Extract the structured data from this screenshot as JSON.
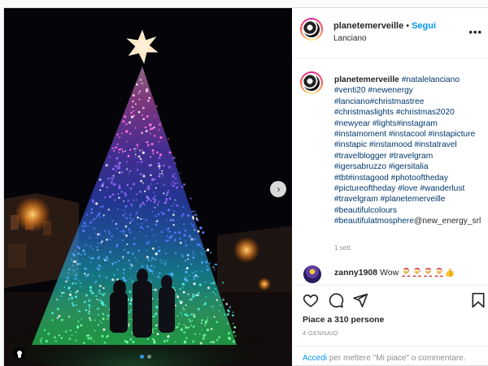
{
  "post": {
    "username": "planetemerveille",
    "follow_label": "Segui",
    "separator": "•",
    "location": "Lanciano",
    "more_label": "•••"
  },
  "caption": {
    "username": "planetemerveille",
    "hashtags": "#natalelanciano #venti20 #newenergy #lanciano#christmastree #christmaslights #christmas2020 #newyear #lights#instagram #instamoment #instacool #instapicture #instapic #instamood #instatravel #travelblogger #travelgram #igersabruzzo #igersitalia #tbt#instagood #photooftheday #pictureoftheday #love #wanderlust #travelgram #planetemerveille #beautifulcolours #beautifulatmosphere",
    "mention": "@new_energy_srl",
    "time": "1 sett."
  },
  "comment": {
    "username": "zanny1908",
    "text": "Wow",
    "emojis": "🎅🎅🎅🎅👍"
  },
  "actions": {
    "likes": "Piace a 310 persone",
    "date": "4 GENNAIO",
    "login_link": "Accedi",
    "login_rest": " per mettere \"Mi piace\" o commentare."
  },
  "icons": {
    "heart": "heart-icon",
    "comment": "comment-icon",
    "share": "share-icon",
    "save": "bookmark-icon",
    "next": "chevron-right-icon",
    "tag": "user-tag-icon"
  },
  "carousel": {
    "slides": 2,
    "active": 0
  },
  "colors": {
    "link": "#00376b",
    "accent": "#0095f6"
  }
}
